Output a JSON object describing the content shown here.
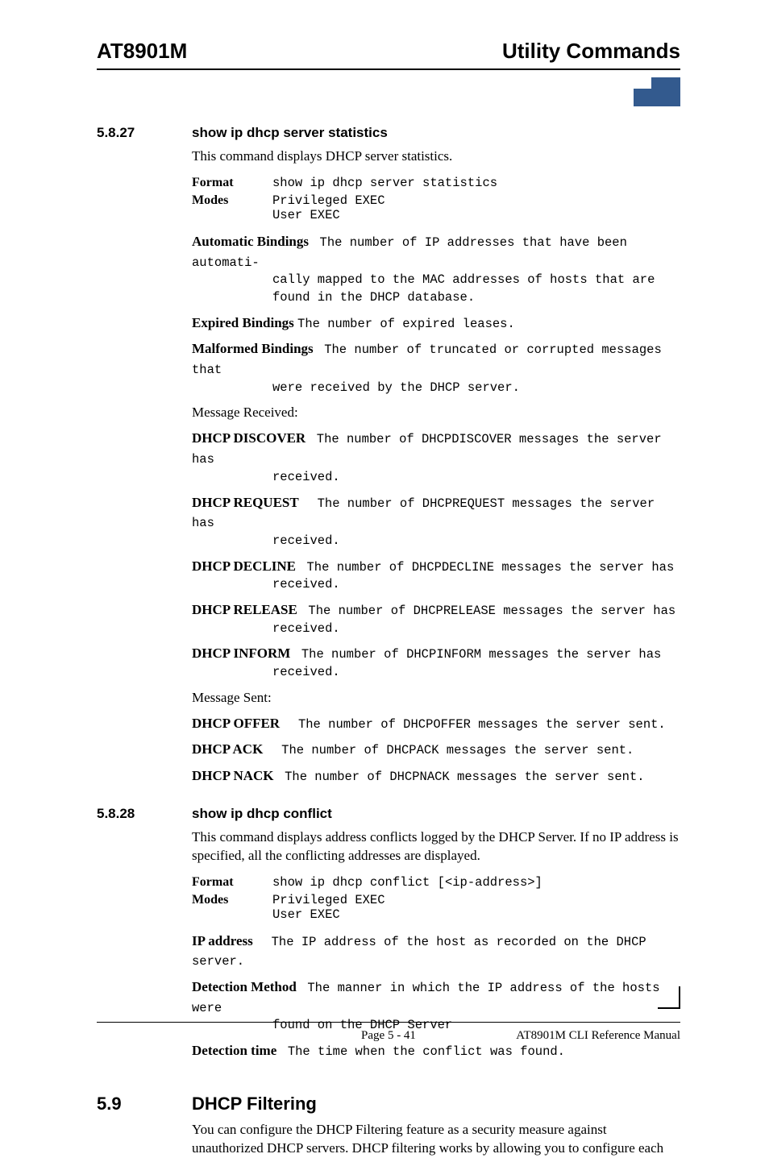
{
  "header": {
    "left": "AT8901M",
    "right": "Utility Commands"
  },
  "sections": [
    {
      "number": "5.8.27",
      "title": "show ip dhcp server statistics",
      "intro": "This command displays DHCP server statistics.",
      "format_label": "Format",
      "format_value": "show ip dhcp server statistics",
      "modes_label": "Modes",
      "modes_values": [
        "Privileged EXEC",
        "User EXEC"
      ],
      "defs1": [
        {
          "label": "Automatic Bindings",
          "text": "The number of IP addresses that have been automatically mapped to the MAC addresses of hosts that are found in the DHCP database."
        },
        {
          "label": "Expired Bindings",
          "text": "The number of expired leases."
        },
        {
          "label": "Malformed Bindings",
          "text": "The number of truncated or corrupted messages that were received by the DHCP server."
        }
      ],
      "msg_received_label": "Message Received:",
      "received": [
        {
          "label": "DHCP DISCOVER",
          "text": "The number of DHCPDISCOVER messages the server has received."
        },
        {
          "label": "DHCP REQUEST",
          "text": "The number of DHCPREQUEST messages the server has received."
        },
        {
          "label": "DHCP DECLINE",
          "text": "The number of DHCPDECLINE messages the server has received."
        },
        {
          "label": "DHCP RELEASE",
          "text": "The number of DHCPRELEASE messages the server has received."
        },
        {
          "label": "DHCP INFORM",
          "text": "The number of DHCPINFORM messages the server has received."
        }
      ],
      "msg_sent_label": "Message Sent:",
      "sent": [
        {
          "label": "DHCP OFFER",
          "text": "The number of DHCPOFFER messages the server sent."
        },
        {
          "label": "DHCP ACK",
          "text": "The number of DHCPACK messages the server sent."
        },
        {
          "label": "DHCP NACK",
          "text": "The number of DHCPNACK messages the server sent."
        }
      ]
    },
    {
      "number": "5.8.28",
      "title": "show ip dhcp conflict",
      "intro": "This command displays address conflicts logged by the DHCP Server. If no IP address is specified, all the conflicting addresses are displayed.",
      "format_label": "Format",
      "format_value": "show ip dhcp conflict ",
      "format_arg": "[<ip-address>]",
      "modes_label": "Modes",
      "modes_values": [
        "Privileged EXEC",
        "User EXEC"
      ],
      "defs": [
        {
          "label": "IP address",
          "text": "The IP address of the host as recorded on the DHCP server."
        },
        {
          "label": "Detection Method",
          "text": "The manner in which the IP address of the hosts were found on the DHCP Server"
        },
        {
          "label": "Detection time",
          "text": "The time when the conflict was found."
        }
      ]
    }
  ],
  "h2": {
    "number": "5.9",
    "title": "DHCP Filtering",
    "intro": "You can configure the DHCP Filtering feature as a security measure against unauthorized DHCP servers. DHCP filtering works by allowing you to configure each"
  },
  "footer": {
    "page": "Page 5 - 41",
    "manual": "AT8901M CLI Reference Manual"
  }
}
